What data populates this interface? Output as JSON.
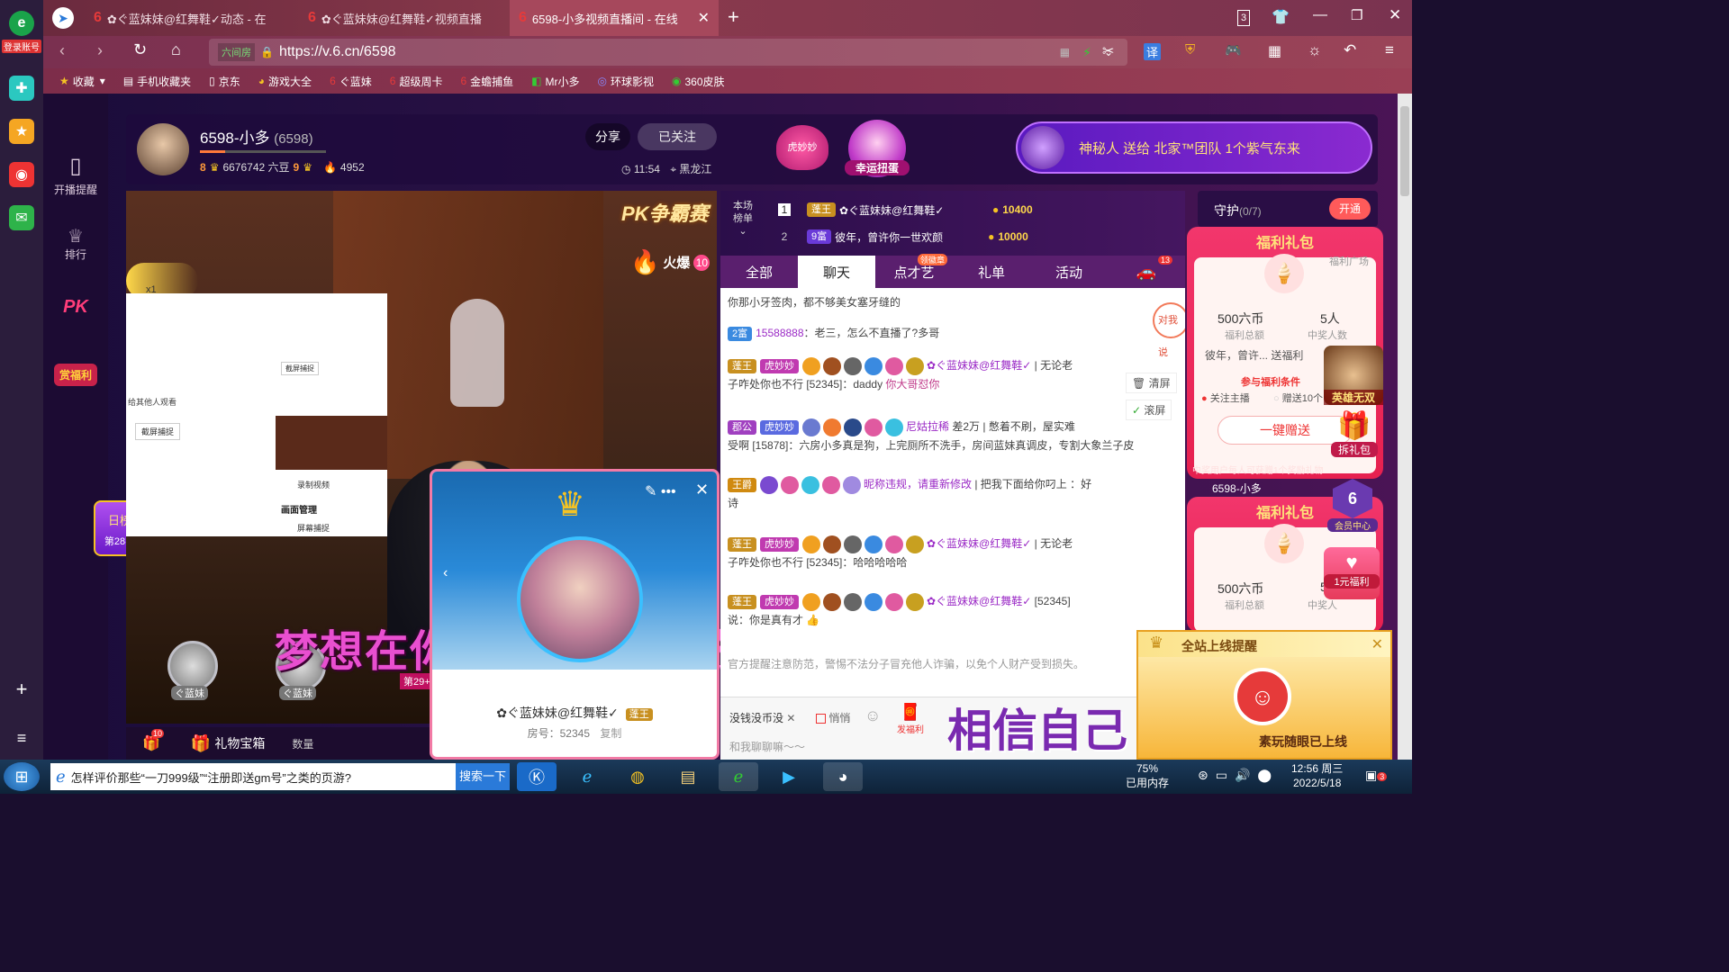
{
  "browser": {
    "login_label": "登录账号",
    "tabs": [
      {
        "label": "✿ぐ蓝妹妹@红舞鞋✓动态 - 在"
      },
      {
        "label": "✿ぐ蓝妹妹@红舞鞋✓视频直播"
      },
      {
        "label": "6598-小多视频直播间 - 在线"
      }
    ],
    "tab_count": "3",
    "safe_label": "六间房",
    "url": "https://v.6.cn/6598",
    "bookmarks": [
      "收藏",
      "手机收藏夹",
      "京东",
      "游戏大全",
      "ぐ蓝妹",
      "超级周卡",
      "金蟾捕鱼",
      "Mr小多",
      "环球影视",
      "360皮肤"
    ]
  },
  "site_nav": {
    "items": [
      {
        "label": "开播提醒"
      },
      {
        "label": "排行"
      },
      {
        "label": "PK"
      },
      {
        "label": "赏福利"
      },
      {
        "label": "日榜"
      },
      {
        "label": "第28名"
      }
    ]
  },
  "host": {
    "name": "6598-小多",
    "room_id": "(6598)",
    "level_a": "8",
    "beans": "6676742 六豆",
    "level_b": "9",
    "fans": "4952",
    "share_label": "分享",
    "follow_label": "已关注",
    "time": "11:54",
    "location": "黑龙江"
  },
  "header_promos": {
    "badge": "虎妙妙",
    "lucky_egg": "幸运扭蛋",
    "announce": "神秘人 送给 北家™团队 1个紫气东来"
  },
  "video": {
    "pk_label": "PK争霸赛",
    "hot_label": "火爆",
    "hot_value": "10",
    "gift_counts": [
      "x1",
      "x1"
    ],
    "mini_texts": [
      "给其他人观看",
      "截屏捕捉",
      "录制视频",
      "画面管理",
      "屏幕捕捉",
      "截屏捕捉"
    ],
    "seat_names": [
      "ぐ蓝妹",
      "ぐ蓝妹"
    ],
    "rank_text": "第29+",
    "subtitle": "梦想在你手中 这是你的天地",
    "bottom_label": "礼物宝箱",
    "qty_label": "数量",
    "gift_count_badge": "10"
  },
  "popup": {
    "user": "✿ぐ蓝妹妹@红舞鞋✓",
    "tag": "蓬王",
    "room_label": "房号：52345",
    "copy_label": "复制"
  },
  "chat": {
    "rank_label_1": "本场",
    "rank_label_2": "榜单",
    "rank_rows": [
      {
        "rank": "1",
        "badge": "蓬王",
        "name": "✿ぐ蓝妹妹@红舞鞋✓",
        "coins": "10400"
      },
      {
        "rank": "2",
        "badge": "9富",
        "name": "彼年，曾许你一世欢颜",
        "coins": "10000"
      }
    ],
    "tabs": [
      {
        "label": "全部"
      },
      {
        "label": "聊天"
      },
      {
        "label": "点才艺"
      },
      {
        "label": "礼单"
      },
      {
        "label": "活动"
      }
    ],
    "tab_badge": "领徽章",
    "car_count": "13",
    "messages": [
      {
        "text": "你那小牙签肉，都不够美女塞牙缝的"
      },
      {
        "level": "2富",
        "name": "15588888",
        "text": "：老三，怎么不直播了?多哥"
      },
      {
        "level": "蓬王",
        "badge": "虎妙妙",
        "name": "✿ぐ蓝妹妹@红舞鞋✓",
        "extra": "无论老",
        "text2": "子咋处你也不行 [52345]：daddy",
        "text3": "你大哥怼你"
      },
      {
        "level": "郡公",
        "badge": "虎妙妙",
        "name": "尼姑拉稀",
        "extra": "差2万 | 憋着不刷，屋实难",
        "text2": "受啊 [15878]：六房小多真是狗，上完厕所不洗手，房间蓝妹真调皮，专割大象兰子皮"
      },
      {
        "level": "王爵",
        "name": "昵称违规，请重新修改",
        "extra": "| 把我下面给你叼上 ：好",
        "text2": "诗"
      },
      {
        "level": "蓬王",
        "badge": "虎妙妙",
        "name": "✿ぐ蓝妹妹@红舞鞋✓",
        "extra": "无论老",
        "text2": "子咋处你也不行 [52345]：哈哈哈哈哈"
      },
      {
        "level": "蓬王",
        "badge": "虎妙妙",
        "name": "✿ぐ蓝妹妹@红舞鞋✓",
        "extra": "[52345]",
        "text2": "说：你是真有才"
      },
      {
        "text": "官方提醒注意防范，警惕不法分子冒充他人诈骗，以免个人财产受到损失。"
      }
    ],
    "clear_label": "清屏",
    "scroll_label": "滚屏",
    "float_label": "对我说",
    "input_chip": "没钱没币没",
    "secret_label": "悄悄",
    "welfare_label": "发福利",
    "input_placeholder": "和我聊聊嘛～～",
    "overlay_text": "相信自己"
  },
  "right_panel": {
    "guard_label": "守护",
    "guard_count": "(0/7)",
    "open_label": "开通",
    "welfare_title": "福利礼包",
    "welfare_square": "福利广场",
    "total_value": "500六币",
    "total_label": "福利总额",
    "winners_value": "5人",
    "winners_label": "中奖人数",
    "sender": "彼年，曾许...",
    "sent_label": "送福利",
    "cond_label": "参与福利条件",
    "cond_1": "关注主播",
    "cond_2": "赠送10个",
    "gift_btn": "一键赠送",
    "gift_note": "中奖用户每人可获赠1个奖励礼物",
    "host_tag": "6598-小多",
    "hero_label": "英雄无双",
    "gift_pack": "拆礼包",
    "member_label": "会员中心",
    "one_yuan": "1元福利",
    "winners_value_2": "5",
    "winners_label_2": "中奖人"
  },
  "online_notice": {
    "title": "全站上线提醒",
    "user_line": "素玩随眼已上线"
  },
  "taskbar": {
    "search_text": "怎样评价那些“一刀999级”“注册即送gm号”之类的页游?",
    "search_btn": "搜索一下",
    "mem_pct": "75%",
    "mem_label": "已用内存",
    "time": "12:56 周三",
    "date": "2022/5/18",
    "notif": "3"
  }
}
